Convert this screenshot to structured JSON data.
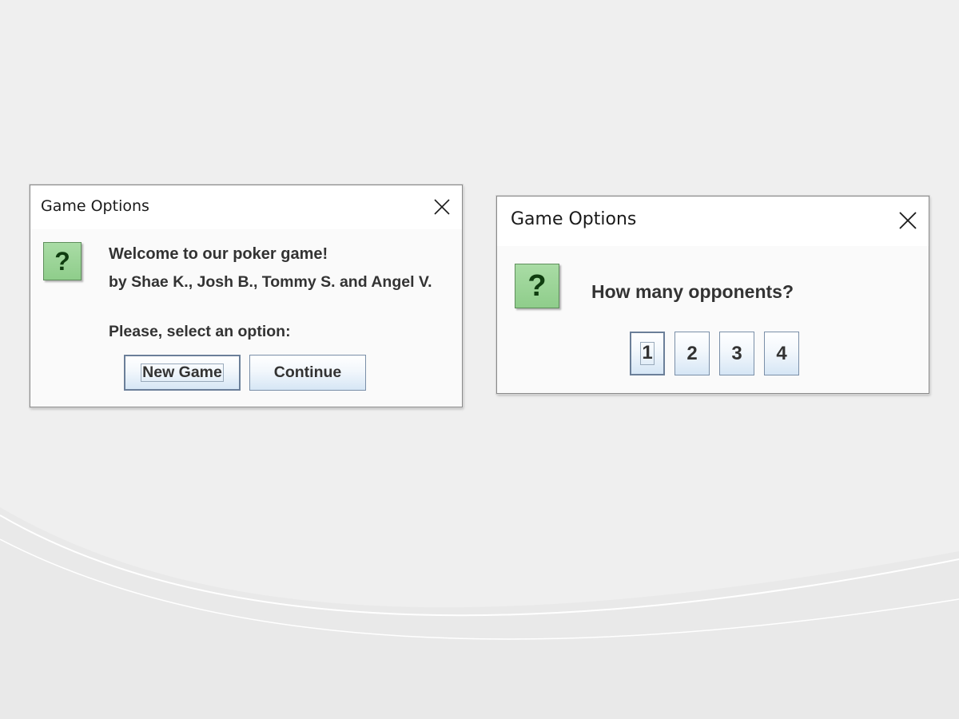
{
  "colors": {
    "background": "#efefef",
    "icon_green": "#9fd69b",
    "button_border": "#7a8fa8"
  },
  "dialog_welcome": {
    "title": "Game Options",
    "close_icon": "close-icon",
    "icon": "question-icon",
    "icon_glyph": "?",
    "line1": "Welcome to our poker game!",
    "line2": "by Shae K., Josh B., Tommy S. and Angel V.",
    "line3": "Please, select an option:",
    "buttons": {
      "new_game": "New Game",
      "continue": "Continue"
    },
    "focused_button": "New Game"
  },
  "dialog_opponents": {
    "title": "Game Options",
    "close_icon": "close-icon",
    "icon": "question-icon",
    "icon_glyph": "?",
    "question": "How many opponents?",
    "options": [
      "1",
      "2",
      "3",
      "4"
    ],
    "focused_option": "1"
  }
}
